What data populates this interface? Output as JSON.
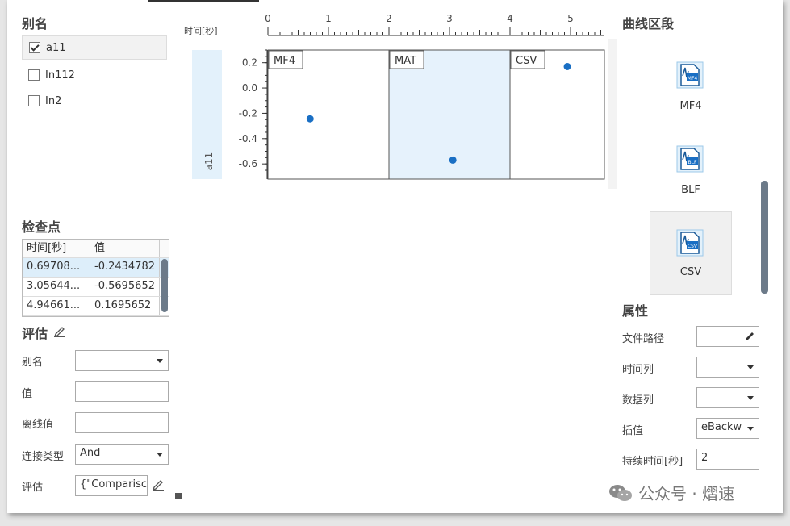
{
  "alias": {
    "title": "别名",
    "items": [
      {
        "label": "a11",
        "checked": true
      },
      {
        "label": "In112",
        "checked": false
      },
      {
        "label": "In2",
        "checked": false
      }
    ]
  },
  "checkpoints": {
    "title": "检查点",
    "columns": [
      "时间[秒]",
      "值"
    ],
    "rows": [
      [
        "0.69708...",
        "-0.2434782"
      ],
      [
        "3.05644...",
        "-0.5695652"
      ],
      [
        "4.94661...",
        "0.1695652"
      ]
    ]
  },
  "evaluate": {
    "title": "评估",
    "fields": {
      "alias_label": "别名",
      "alias_value": "",
      "value_label": "值",
      "value_value": "",
      "offline_label": "离线值",
      "offline_value": "",
      "join_label": "连接类型",
      "join_value": "And",
      "eval_label": "评估",
      "eval_value": "{\"Comparisc"
    }
  },
  "chart": {
    "x_axis_title": "时间[秒]",
    "x_ticks": [
      "0",
      "1",
      "2",
      "3",
      "4",
      "5"
    ],
    "y_ticks": [
      "0.2",
      "0.0",
      "-0.2",
      "-0.4",
      "-0.6"
    ],
    "y_label": "a11",
    "segments": [
      "MF4",
      "MAT",
      "CSV"
    ]
  },
  "chart_data": {
    "type": "scatter",
    "xlabel": "时间[秒]",
    "ylabel": "a11",
    "xlim": [
      0,
      5.5
    ],
    "ylim": [
      -0.7,
      0.3
    ],
    "points": [
      {
        "x": 0.697,
        "y": -0.2435
      },
      {
        "x": 3.056,
        "y": -0.5696
      },
      {
        "x": 4.947,
        "y": 0.1696
      }
    ],
    "segments": [
      {
        "label": "MF4",
        "start": 0,
        "end": 2
      },
      {
        "label": "MAT",
        "start": 2,
        "end": 4,
        "highlighted": true
      },
      {
        "label": "CSV",
        "start": 4,
        "end": 5.5
      }
    ],
    "point_color": "#1a6fc4",
    "highlight_color": "#e6f2fc"
  },
  "curve_segments": {
    "title": "曲线区段",
    "items": [
      {
        "label": "MF4",
        "icon": "mf4-file-icon",
        "badge": "MF4"
      },
      {
        "label": "BLF",
        "icon": "blf-file-icon",
        "badge": "BLF"
      },
      {
        "label": "CSV",
        "icon": "csv-file-icon",
        "badge": "CSV"
      }
    ]
  },
  "properties": {
    "title": "属性",
    "file_path_label": "文件路径",
    "file_path_value": "",
    "time_col_label": "时间列",
    "time_col_value": "",
    "data_col_label": "数据列",
    "data_col_value": "",
    "interp_label": "插值",
    "interp_value": "eBackw",
    "duration_label": "持续时间[秒]",
    "duration_value": "2"
  },
  "watermark": {
    "text": "公众号 · 熠速"
  }
}
